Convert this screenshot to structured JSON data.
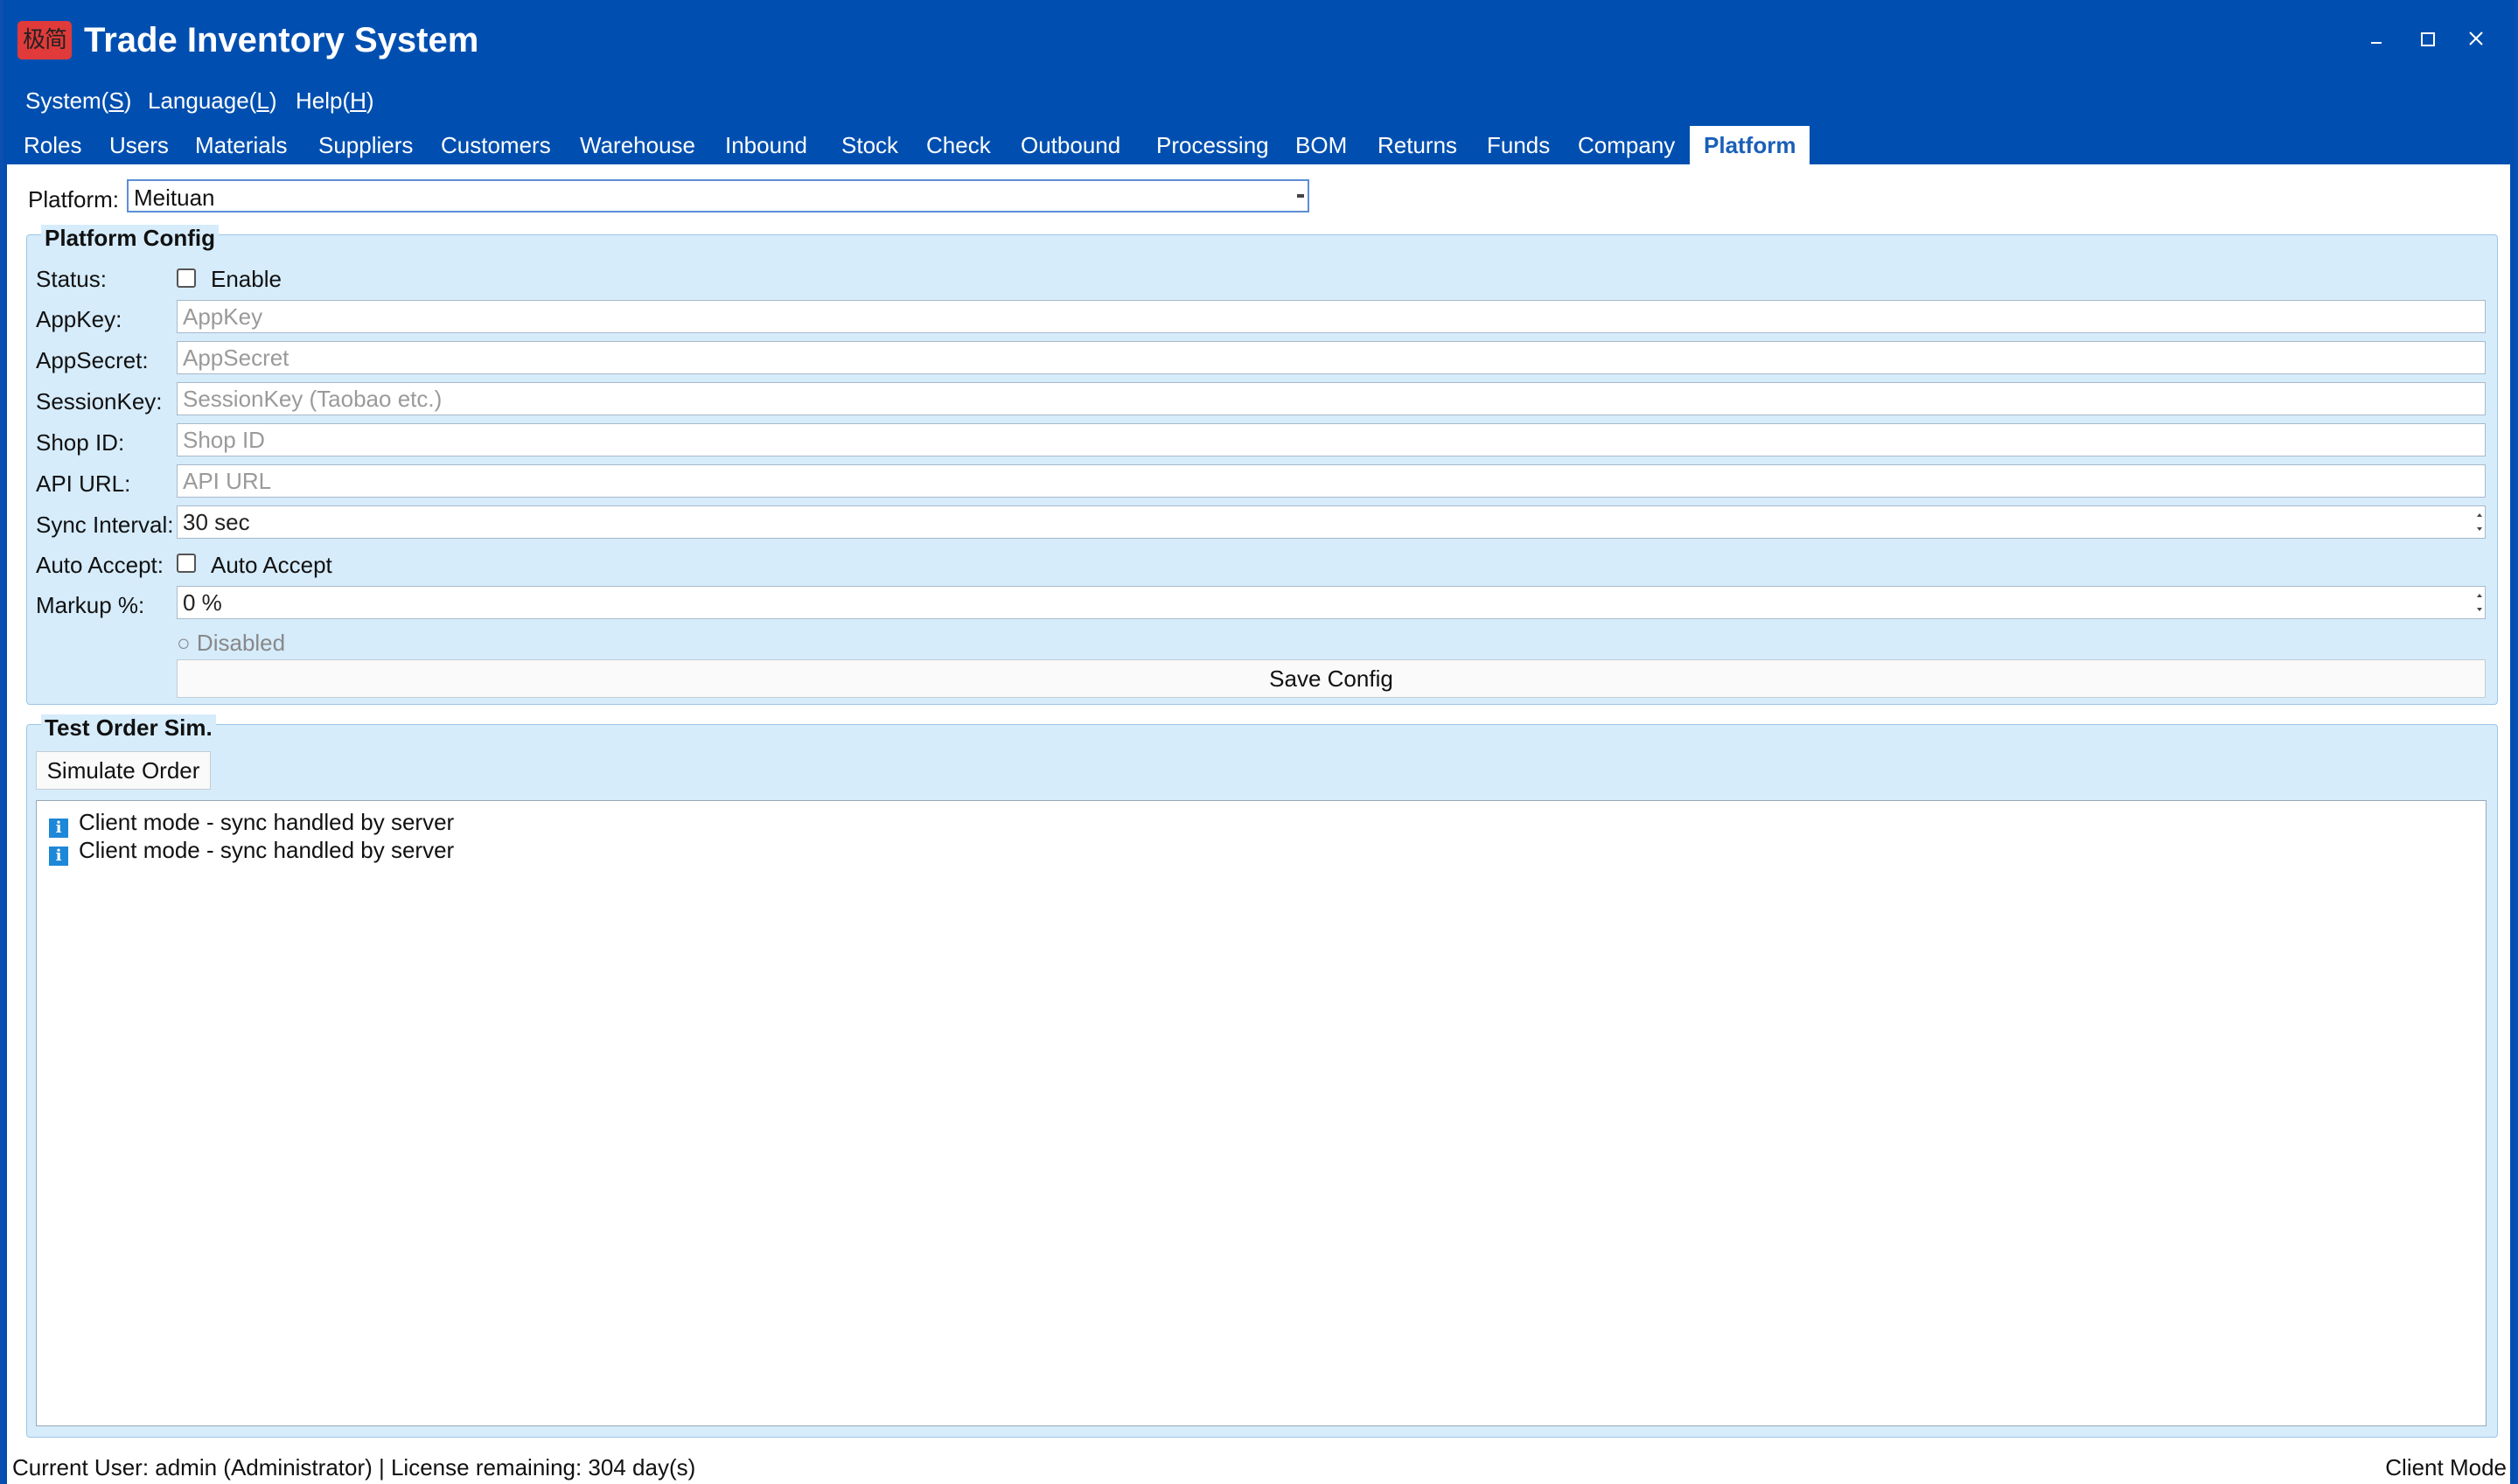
{
  "window": {
    "logo_text": "极简",
    "title": "Trade Inventory System"
  },
  "menu": [
    {
      "label": "System(",
      "key": "S",
      "end": ")"
    },
    {
      "label": "Language(",
      "key": "L",
      "end": ")"
    },
    {
      "label": "Help(",
      "key": "H",
      "end": ")"
    }
  ],
  "tabs": [
    "Roles",
    "Users",
    "Materials",
    "Suppliers",
    "Customers",
    "Warehouse",
    "Inbound",
    "Stock",
    "Check",
    "Outbound",
    "Processing",
    "BOM",
    "Returns",
    "Funds",
    "Company",
    "Platform"
  ],
  "active_tab": "Platform",
  "platform": {
    "label": "Platform:",
    "selected": "Meituan"
  },
  "config": {
    "title": "Platform Config",
    "status_label": "Status:",
    "enable_label": "Enable",
    "appkey_label": "AppKey:",
    "appkey_placeholder": "AppKey",
    "appsecret_label": "AppSecret:",
    "appsecret_placeholder": "AppSecret",
    "sessionkey_label": "SessionKey:",
    "sessionkey_placeholder": "SessionKey (Taobao etc.)",
    "shopid_label": "Shop ID:",
    "shopid_placeholder": "Shop ID",
    "apiurl_label": "API URL:",
    "apiurl_placeholder": "API URL",
    "sync_label": "Sync Interval:",
    "sync_value": "30 sec",
    "autoaccept_label": "Auto Accept:",
    "autoaccept_check_label": "Auto Accept",
    "markup_label": "Markup %:",
    "markup_value": "0 %",
    "disabled_text": "○ Disabled",
    "save_label": "Save Config"
  },
  "test": {
    "title": "Test Order Sim.",
    "simulate_label": "Simulate Order",
    "log": [
      "Client mode - sync handled by server",
      "Client mode - sync handled by server"
    ]
  },
  "status": {
    "left": "Current User: admin (Administrator)  |  License remaining: 304 day(s)",
    "right": "Client Mode"
  }
}
